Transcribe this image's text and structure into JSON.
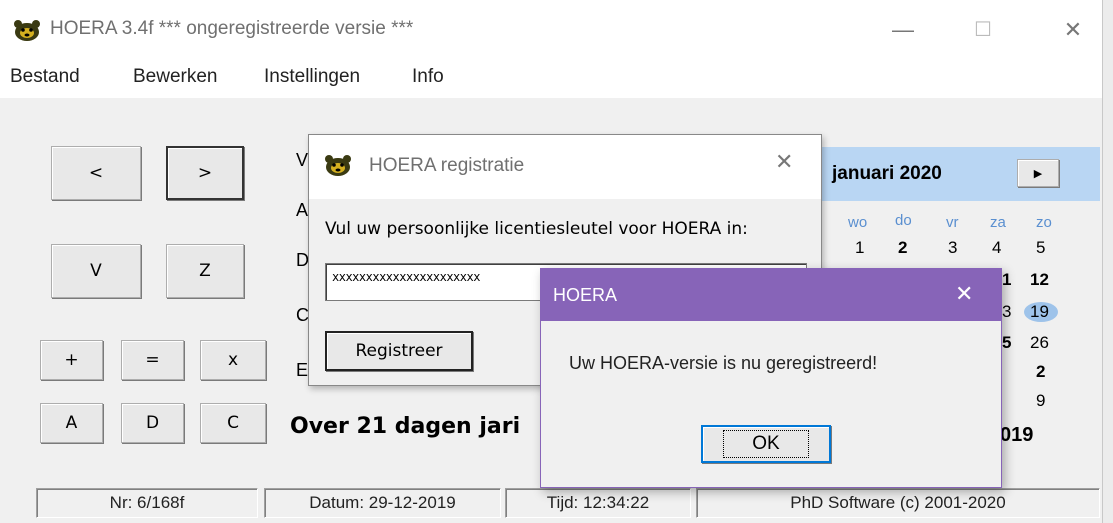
{
  "window": {
    "title": "HOERA 3.4f *** ongeregistreerde versie ***",
    "minimize_glyph": "—",
    "maximize_glyph": "☐",
    "close_glyph": "✕"
  },
  "menu": [
    "Bestand",
    "Bewerken",
    "Instellingen",
    "Info"
  ],
  "nav_buttons": {
    "prev": "<",
    "next": ">",
    "v": "V",
    "z": "Z"
  },
  "op_buttons": {
    "plus": "+",
    "equals": "=",
    "times": "x",
    "a": "A",
    "d": "D",
    "c": "C"
  },
  "side_labels": [
    "V",
    "A",
    "D",
    "C",
    "E"
  ],
  "countdown_text": "Over 21 dagen jari",
  "calendar": {
    "month_label": "januari 2020",
    "next_glyph": "▶",
    "dow": [
      "wo",
      "do",
      "vr",
      "za",
      "zo"
    ],
    "row1": [
      "1",
      "2",
      "3",
      "4",
      "5"
    ],
    "row2_tail": [
      "1",
      "12"
    ],
    "row3_tail": [
      "3",
      "19"
    ],
    "row4_tail": [
      "5",
      "26"
    ],
    "row5_tail": [
      "2"
    ],
    "row6_tail": [
      "9"
    ],
    "year_fragment": "019"
  },
  "status": {
    "nr": "Nr: 6/168f",
    "datum": "Datum: 29-12-2019",
    "tijd": "Tijd: 12:34:22",
    "copyright": "PhD Software (c) 2001-2020"
  },
  "reg_dialog": {
    "title": "HOERA registratie",
    "close_glyph": "✕",
    "prompt": "Vul uw persoonlijke licentiesleutel voor HOERA in:",
    "key_value": "xxxxxxxxxxxxxxxxxxxxxx",
    "register_label": "Registreer"
  },
  "message_box": {
    "title": "HOERA",
    "close_glyph": "✕",
    "message": "Uw HOERA-versie is nu geregistreerd!",
    "ok_label": "OK"
  },
  "colors": {
    "msg_title_bg": "#8764b8",
    "calendar_header_bg": "#b9d6f3",
    "today_highlight": "#9ec3ea"
  }
}
